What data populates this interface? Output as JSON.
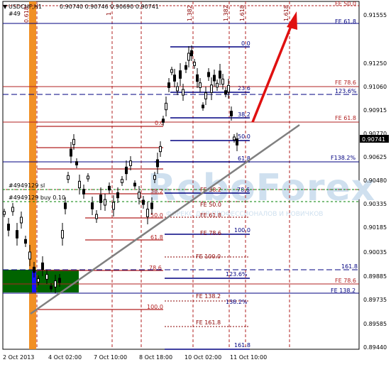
{
  "header": {
    "symbol": "USDCHF,H1",
    "ohlc": "0.90740 0.90746 0.90690 0.90741",
    "ticket_tag": "#49"
  },
  "price_axis": {
    "labels": [
      "0.91555",
      "0.91250",
      "0.91060",
      "0.90915",
      "0.90770",
      "0.90625",
      "0.90480",
      "0.90335",
      "0.90185",
      "0.90035",
      "0.89885",
      "0.89735",
      "0.89585",
      "0.89440"
    ],
    "current_price": "0.90741"
  },
  "time_axis": {
    "labels": [
      "2 Oct 2013",
      "4 Oct 02:00",
      "7 Oct 10:00",
      "8 Oct 18:00",
      "10 Oct 02:00",
      "11 Oct 10:00"
    ]
  },
  "vertical_time_labels": [
    "0.618",
    "1",
    "1.382",
    "1.382",
    "1.618",
    "1.618"
  ],
  "orders": [
    "#4949129 sl",
    "#4949129 buy 0.10"
  ],
  "watermark": "RoboForex",
  "watermark_tagline": "ФОРЕКС ДЛЯ ПРОФЕССИОНАЛОВ И НОВИЧКОВ",
  "levels": {
    "right_edge": [
      "FE 50.0",
      "FE 61.8",
      "FE 78.6",
      "123.6%",
      "FE 61.8",
      "F138.2%",
      "161.8",
      "FE 78.6",
      "FE 138.2"
    ],
    "upper_grid": [
      "0.0",
      "23.6",
      "38.2",
      "50.0",
      "61.8",
      "0.0"
    ],
    "middle_grid": [
      "38.2",
      "50.0",
      "61.8",
      "FE 38.2",
      "78.6",
      "FE 50.0",
      "FE 61.8",
      "FE 78.6",
      "100.0",
      "FE 100.0"
    ],
    "lower_grid": [
      "78.6",
      "123.6%",
      "138.2%",
      "FE 138.2",
      "100.0",
      "FE 161.8",
      "161.8",
      "161.8"
    ]
  },
  "colors": {
    "background": "#ffffff",
    "candles": "#000000",
    "fib_dark": "#000080",
    "fib_red": "#b22222",
    "fe_red": "#8b0000",
    "trend_line": "#808080",
    "arrow": "#e01010",
    "orange_band": "#f08a1a",
    "green_box": "#006400",
    "blue_bar": "#1414ff",
    "watermark": "#cfe0ef"
  }
}
